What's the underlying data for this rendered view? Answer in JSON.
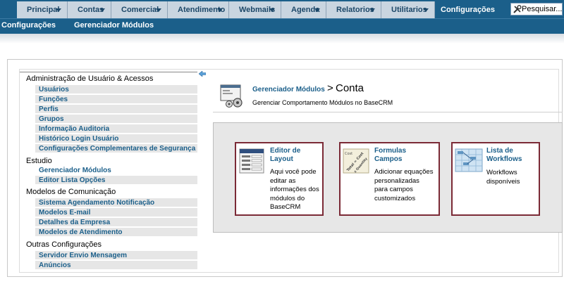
{
  "nav": {
    "items": [
      {
        "label": "Principal"
      },
      {
        "label": "Contas"
      },
      {
        "label": "Comercial"
      },
      {
        "label": "Atendimento"
      },
      {
        "label": "Webmails"
      },
      {
        "label": "Agenda"
      },
      {
        "label": "Relatorios"
      },
      {
        "label": "Utilitarios"
      },
      {
        "label": "Configurações"
      }
    ],
    "search_placeholder": "Pesquisar..."
  },
  "subnav": {
    "items": [
      {
        "label": "Configurações"
      },
      {
        "label": "Gerenciador Módulos"
      }
    ]
  },
  "sidebar": {
    "sections": [
      {
        "title": "Administração de Usuário & Acessos",
        "links": [
          "Usuários",
          "Funções",
          "Perfis",
          "Grupos",
          "Informação Auditoria",
          "Histórico Login Usuário",
          "Configurações Complementares de Segurança"
        ]
      },
      {
        "title": "Estudio",
        "links": [
          "Gerenciador Módulos",
          "Editor Lista Opções"
        ]
      },
      {
        "title": "Modelos de Comunicação",
        "links": [
          "Sistema Agendamento Notificação",
          "Modelos E-mail",
          "Detalhes da Empresa",
          "Modelos de Atendimento"
        ]
      },
      {
        "title": "Outras Configurações",
        "links": [
          "Servidor Envio Mensagem",
          "Anúncios"
        ]
      }
    ]
  },
  "content": {
    "breadcrumb_link": "Gerenciador Módulos",
    "breadcrumb_sep": ">",
    "breadcrumb_current": "Conta",
    "description": "Gerenciar Comportamento Módulos no BaseCRM",
    "tiles": [
      {
        "title": "Editor de\nLayout",
        "description": "Aqui você pode\neditar as\ninformações dos\nmódulos do\nBaseCRM"
      },
      {
        "title": "Formulas\nCampos",
        "description": "Adicionar equações\npersonalizadas\npara campos\ncustomizados"
      },
      {
        "title": "Lista de\nWorkflows",
        "description": "Workflows\ndisponíveis"
      }
    ],
    "formula_icon_text": [
      "Cost",
      "Total = Cost",
      "x Quantity"
    ]
  },
  "colors": {
    "nav_bg": "#1b5f8a",
    "tab_bg": "#c9d5e0",
    "link": "#1b5f8a",
    "tile_border": "#7b2a36"
  }
}
